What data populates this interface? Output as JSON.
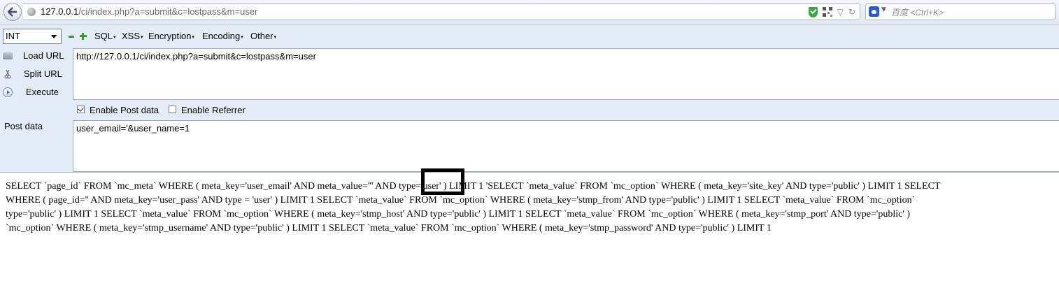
{
  "browser": {
    "url_host": "127.0.0.1",
    "url_path": "/ci/index.php?a=submit&c=lostpass&m=user",
    "search_placeholder": "百度 <Ctrl+K>"
  },
  "hackbar": {
    "select_value": "INT",
    "menu": [
      "SQL",
      "XSS",
      "Encryption",
      "Encoding",
      "Other"
    ],
    "side_buttons": [
      "Load URL",
      "Split URL",
      "Execute"
    ],
    "url_value": "http://127.0.0.1/ci/index.php?a=submit&c=lostpass&m=user",
    "enable_post_label": "Enable Post data",
    "enable_post_checked": true,
    "enable_referrer_label": "Enable Referrer",
    "enable_referrer_checked": false,
    "post_label": "Post data",
    "post_value": "user_email='&user_name=1"
  },
  "output": {
    "lines": [
      "SELECT `page_id` FROM `mc_meta` WHERE ( meta_key='user_email' AND meta_value=''' AND type='user' ) LIMIT 1 'SELECT `meta_value` FROM `mc_option` WHERE ( meta_key='site_key' AND type='public' ) LIMIT 1 SELECT",
      "WHERE ( page_id='' AND meta_key='user_pass' AND type = 'user' ) LIMIT 1 SELECT `meta_value` FROM `mc_option` WHERE ( meta_key='stmp_from' AND type='public' ) LIMIT 1 SELECT `meta_value` FROM `mc_option`",
      "type='public' ) LIMIT 1 SELECT `meta_value` FROM `mc_option` WHERE ( meta_key='stmp_host' AND type='public' ) LIMIT 1 SELECT `meta_value` FROM `mc_option` WHERE ( meta_key='stmp_port' AND type='public' )",
      "`mc_option` WHERE ( meta_key='stmp_username' AND type='public' ) LIMIT 1 SELECT `meta_value` FROM `mc_option` WHERE ( meta_key='stmp_password' AND type='public' ) LIMIT 1"
    ]
  }
}
